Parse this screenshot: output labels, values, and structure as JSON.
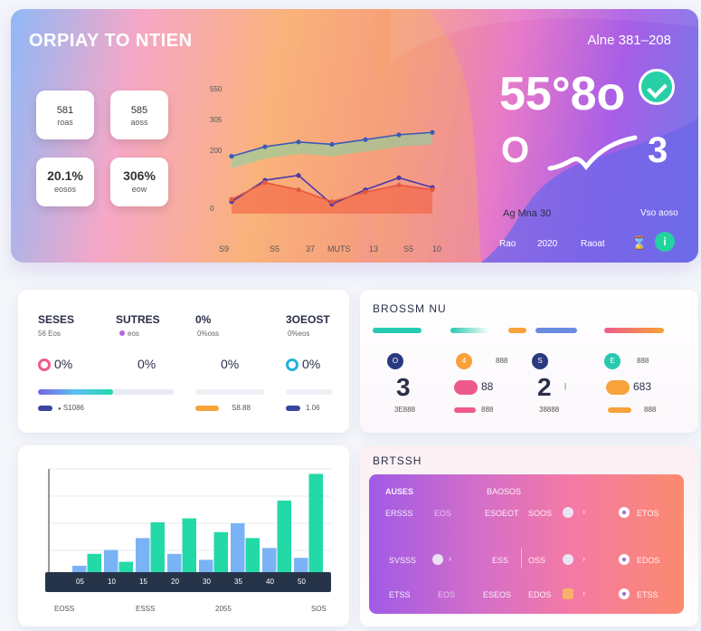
{
  "hero": {
    "title": "ORPIAY TO NTIEN",
    "date": "Alne 381–208",
    "stats": [
      {
        "value": "581",
        "label": "roas"
      },
      {
        "value": "585",
        "label": "aoss"
      },
      {
        "value": "20.1%",
        "label": "eosos"
      },
      {
        "value": "306%",
        "label": "eow"
      }
    ],
    "big_value": "55°8o",
    "big_value_2": "O",
    "big_value_3": "3",
    "subtext": "Ag Mna 30",
    "link": "Vso aoso",
    "footer": [
      "Rao",
      "2020",
      "Raoat"
    ],
    "info_icon": "info-icon",
    "check_icon": "check-icon",
    "y_ticks": [
      "550",
      "305",
      "200",
      "0"
    ],
    "x_ticks": [
      "S9",
      "S5",
      "37",
      "MUTS",
      "13",
      "S5",
      "10"
    ]
  },
  "line_chart": {
    "type": "line",
    "x": [
      "S9",
      "S5",
      "37",
      "MUTS",
      "13",
      "S5",
      "10"
    ],
    "series": [
      {
        "values": [
          48,
          56,
          60,
          58,
          62,
          66,
          68
        ],
        "color": "#3c5ab8"
      },
      {
        "values": [
          10,
          28,
          32,
          8,
          20,
          30,
          22
        ],
        "color": "#4b39a8"
      },
      {
        "values": [
          12,
          26,
          20,
          10,
          18,
          24,
          20
        ],
        "color": "#e4583f"
      }
    ]
  },
  "stats_panel": {
    "headers": [
      "SESES",
      "SUTRES",
      "0%",
      "3OEOST"
    ],
    "subs": [
      "56 Eos",
      "eos",
      "0%oss",
      "0%eos"
    ],
    "ring_values": [
      "0%",
      "0%",
      "0%",
      "0%"
    ],
    "progress": [
      0.55,
      0.3,
      0.2,
      0.35
    ],
    "legend": [
      "S1086",
      "S8.88",
      "1.06"
    ],
    "colors": {
      "blue": "#3a46a0",
      "teal": "#27c9b0",
      "orange": "#f7a23a",
      "pink": "#ef5a8a",
      "purple": "#9b6bf2"
    }
  },
  "progress_panel": {
    "title": "BROSSM NU",
    "items": [
      {
        "icon": "O",
        "num": "3",
        "badge": "88",
        "cap": "3E888",
        "color": "#3a46a0"
      },
      {
        "icon": "4",
        "num": "",
        "badge": "",
        "cap": "888",
        "color": "#f7a23a"
      },
      {
        "icon": "S",
        "num": "2",
        "badge": "",
        "cap": "38888",
        "color": "#3a46a0"
      },
      {
        "icon": "E",
        "num": "",
        "badge": "683",
        "cap": "888",
        "color": "#27c9b0"
      }
    ]
  },
  "bar_chart": {
    "type": "bar",
    "categories": [
      "05",
      "10",
      "15",
      "20",
      "30",
      "35",
      "40",
      "50"
    ],
    "series": [
      {
        "values": [
          12,
          28,
          40,
          24,
          18,
          55,
          30,
          20
        ],
        "color": "#7ab3f5"
      },
      {
        "values": [
          24,
          16,
          56,
          60,
          46,
          40,
          78,
          105
        ],
        "color": "#22d9a7"
      }
    ],
    "ylim": [
      0,
      110
    ],
    "x_labels": [
      "EOSS",
      "ESSS",
      "2055",
      "SOS"
    ]
  },
  "option_panel": {
    "title": "BRTSSH",
    "headers": [
      "AUSES",
      "BAOSOS"
    ],
    "rows": [
      [
        "ERSSS",
        "EOS",
        "ESOEOT",
        "SOOS",
        "ETOS"
      ],
      [
        "SVSSS",
        "ESS",
        "OSS",
        "EDOS",
        ""
      ],
      [
        "ETSS",
        "EOS",
        "ESEOS",
        "EDOS",
        "ETSS"
      ]
    ]
  }
}
